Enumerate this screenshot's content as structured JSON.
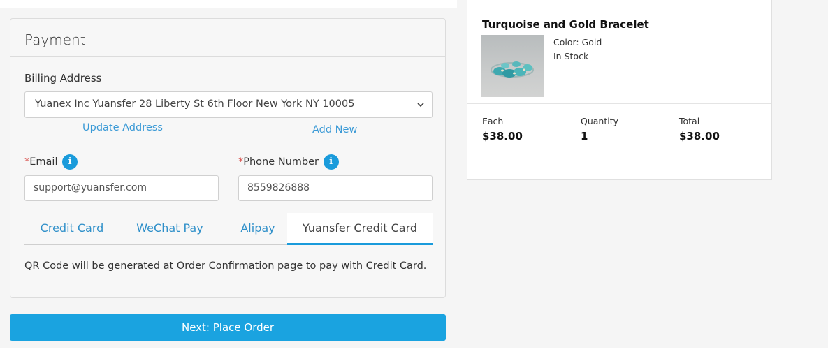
{
  "payment": {
    "title": "Payment",
    "billing_label": "Billing Address",
    "billing_address": "Yuanex Inc Yuansfer 28 Liberty St 6th Floor New York NY 10005",
    "update_address_link": "Update Address",
    "add_new_link": "Add New",
    "email": {
      "required_mark": "*",
      "label": "Email",
      "value": "support@yuansfer.com"
    },
    "phone": {
      "required_mark": "*",
      "label": "Phone Number",
      "value": "8559826888"
    },
    "info_glyph": "i",
    "tabs": [
      {
        "label": "Credit Card",
        "active": false
      },
      {
        "label": "WeChat Pay",
        "active": false
      },
      {
        "label": "Alipay",
        "active": false
      },
      {
        "label": "Yuansfer Credit Card",
        "active": true
      }
    ],
    "qr_note": "QR Code will be generated at Order Confirmation page to pay with Credit Card."
  },
  "next_button": "Next: Place Order",
  "order": {
    "product_name": "Turquoise and Gold Bracelet",
    "color": "Color: Gold",
    "stock": "In Stock",
    "each_label": "Each",
    "each_value": "$38.00",
    "quantity_label": "Quantity",
    "quantity_value": "1",
    "total_label": "Total",
    "total_value": "$38.00"
  },
  "colors": {
    "accent": "#1aa3e0",
    "link": "#3b9ad6",
    "required": "#d9534f",
    "info_icon": "#1a9bdb"
  },
  "icons": [
    "info-icon",
    "chevron-down-icon"
  ]
}
